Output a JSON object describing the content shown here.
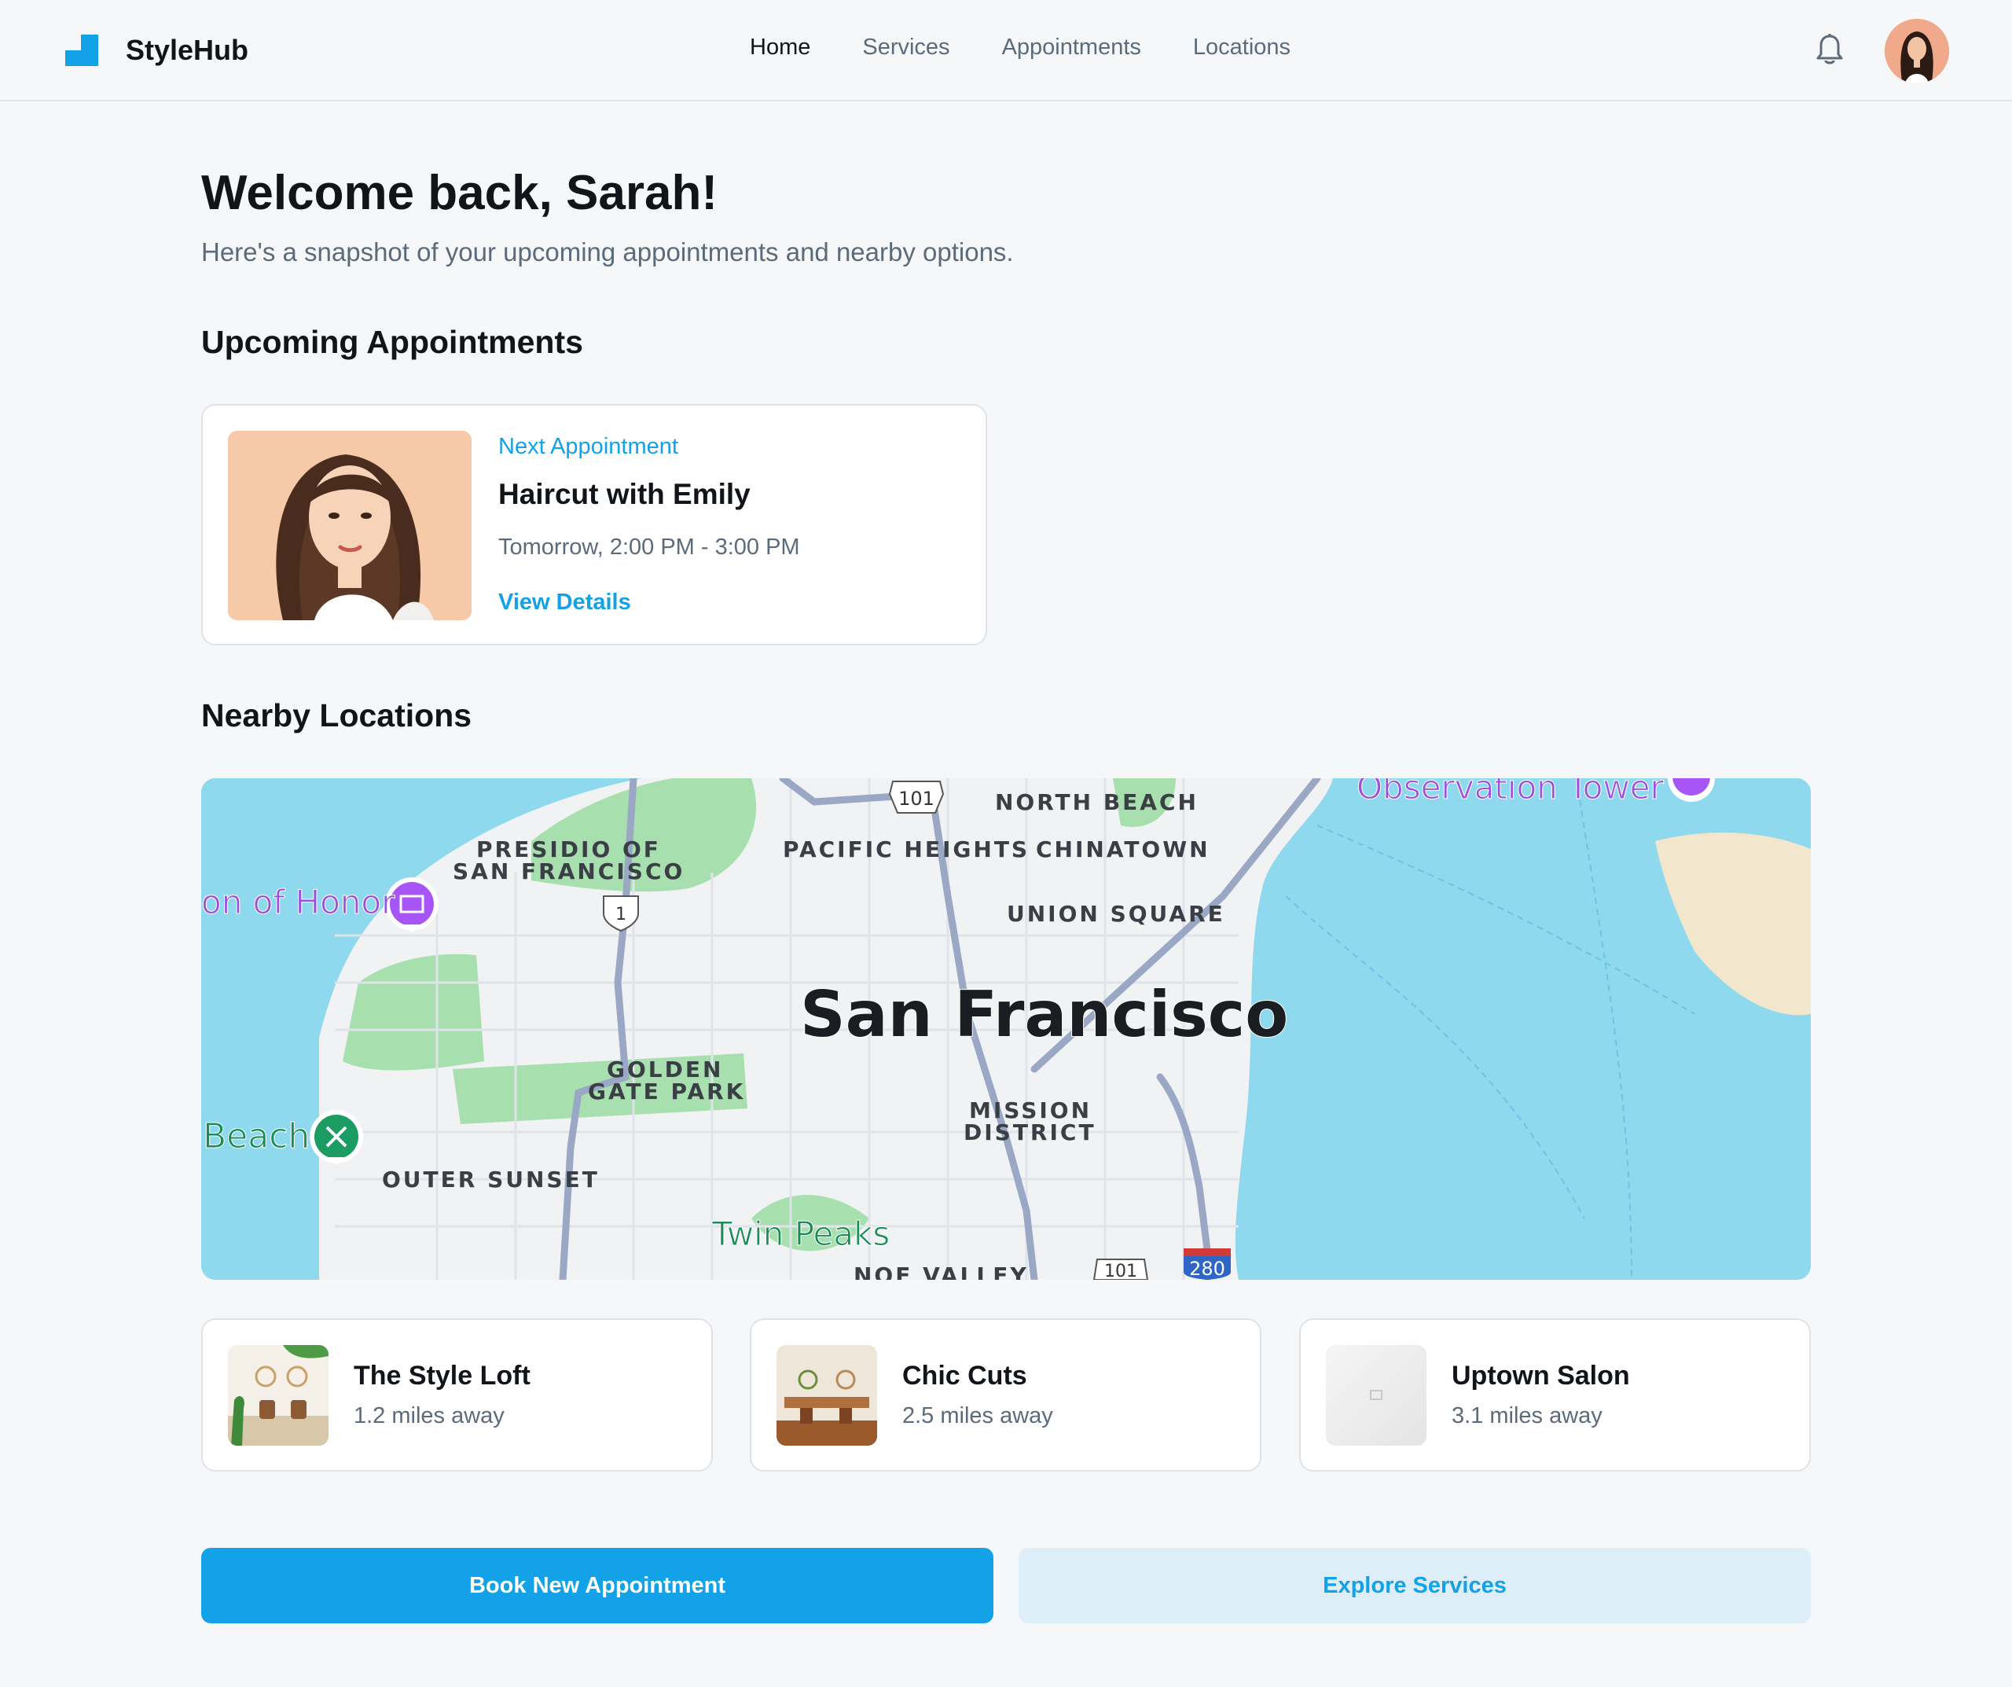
{
  "app": {
    "name": "StyleHub"
  },
  "nav": {
    "items": [
      {
        "label": "Home",
        "active": true
      },
      {
        "label": "Services",
        "active": false
      },
      {
        "label": "Appointments",
        "active": false
      },
      {
        "label": "Locations",
        "active": false
      }
    ]
  },
  "header": {
    "bell_icon": "bell-icon",
    "avatar_icon": "user-avatar"
  },
  "welcome": {
    "title": "Welcome back, Sarah!",
    "subtitle": "Here's a snapshot of your upcoming appointments and nearby options."
  },
  "appointments": {
    "heading": "Upcoming Appointments",
    "next": {
      "eyebrow": "Next Appointment",
      "title": "Haircut with Emily",
      "time": "Tomorrow, 2:00 PM - 3:00 PM",
      "link": "View Details"
    }
  },
  "locations": {
    "heading": "Nearby Locations",
    "map": {
      "labels": {
        "city": "San Francisco",
        "north_beach": "NORTH BEACH",
        "pacific_heights": "PACIFIC HEIGHTS",
        "chinatown": "CHINATOWN",
        "union_square": "UNION SQUARE",
        "presidio_1": "PRESIDIO OF",
        "presidio_2": "SAN FRANCISCO",
        "legion": "on of Honor",
        "golden_1": "GOLDEN",
        "golden_2": "GATE PARK",
        "mission_1": "MISSION",
        "mission_2": "DISTRICT",
        "beach": "Beach",
        "outer_sunset": "OUTER SUNSET",
        "twin_peaks": "Twin Peaks",
        "observation": "Observation Tower",
        "noe_valley": "NOE VALLEY",
        "hwy_101_top": "101",
        "hwy_101_bottom": "101",
        "hwy_1": "1",
        "hwy_280": "280"
      }
    },
    "items": [
      {
        "name": "The Style Loft",
        "distance": "1.2 miles away"
      },
      {
        "name": "Chic Cuts",
        "distance": "2.5 miles away"
      },
      {
        "name": "Uptown Salon",
        "distance": "3.1 miles away"
      }
    ]
  },
  "actions": {
    "primary": "Book New Appointment",
    "secondary": "Explore Services"
  },
  "colors": {
    "accent": "#13a1e8",
    "text": "#111418",
    "muted": "#5b6b7c",
    "background": "#f6f7f8",
    "water": "#8fd9ef"
  }
}
